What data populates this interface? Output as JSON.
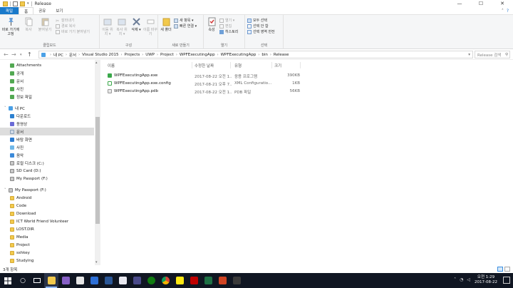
{
  "window": {
    "title": "Release",
    "controls": {
      "minimize": "—",
      "maximize": "☐",
      "close": "✕"
    }
  },
  "ribbon_tabs": [
    "파일",
    "홈",
    "공유",
    "보기"
  ],
  "ribbon": {
    "clipboard": {
      "pin_label": "바로 가기에 고정",
      "copy": "복사",
      "paste": "붙여넣기",
      "cut": "잘라내기",
      "copy_path": "경로 복사",
      "paste_shortcut": "바로 가기 붙여넣기",
      "group": "클립보드"
    },
    "organize": {
      "move_to": "이동 위치 ▾",
      "copy_to": "복사 위치 ▾",
      "delete": "삭제 ▾",
      "rename": "이름 바꾸기",
      "group": "구성"
    },
    "new": {
      "new_folder": "새 폴더",
      "new_item": "새 항목 ▾",
      "easy_access": "빠른 연결 ▾",
      "group": "새로 만들기"
    },
    "open": {
      "properties": "속성",
      "open": "열기 ▾",
      "edit": "편집",
      "history": "히스토리",
      "group": "열기"
    },
    "select": {
      "select_all": "모두 선택",
      "select_none": "선택 안 함",
      "invert": "선택 영역 반전",
      "group": "선택"
    }
  },
  "address": {
    "breadcrumbs": [
      "내 PC",
      "문서",
      "Visual Studio 2015",
      "Projects",
      "UWP",
      "Project",
      "WPFExecutingApp",
      "WPFExecutingApp",
      "bin",
      "Release"
    ],
    "search_placeholder": "Release 검색",
    "back": "←",
    "forward": "→",
    "up": "↑"
  },
  "nav": {
    "items": [
      {
        "label": "Attachments",
        "icon": "folder-icon"
      },
      {
        "label": "공개",
        "icon": "folder-icon"
      },
      {
        "label": "문서",
        "icon": "folder-icon"
      },
      {
        "label": "사진",
        "icon": "folder-icon"
      },
      {
        "label": "정보 파일",
        "icon": "folder-icon"
      },
      {
        "label": "내 PC",
        "icon": "pc-icon"
      },
      {
        "label": "다운로드",
        "icon": "download-icon"
      },
      {
        "label": "동영상",
        "icon": "video-icon"
      },
      {
        "label": "문서",
        "icon": "documents-icon"
      },
      {
        "label": "바탕 화면",
        "icon": "desktop-icon"
      },
      {
        "label": "사진",
        "icon": "pictures-icon"
      },
      {
        "label": "음악",
        "icon": "music-icon"
      },
      {
        "label": "로컬 디스크 (C:)",
        "icon": "drive-icon"
      },
      {
        "label": "SD Card (D:)",
        "icon": "drive-icon"
      },
      {
        "label": "My Passport (F:)",
        "icon": "drive-icon"
      },
      {
        "label": "My Passport (F:)",
        "icon": "drive-icon"
      },
      {
        "label": "Android",
        "icon": "folder-icon"
      },
      {
        "label": "Code",
        "icon": "folder-icon"
      },
      {
        "label": "Download",
        "icon": "folder-icon"
      },
      {
        "label": "ICT World Friend Volunteer",
        "icon": "folder-icon"
      },
      {
        "label": "LOST.DIR",
        "icon": "folder-icon"
      },
      {
        "label": "Media",
        "icon": "folder-icon"
      },
      {
        "label": "Project",
        "icon": "folder-icon"
      },
      {
        "label": "sshkey",
        "icon": "folder-icon"
      },
      {
        "label": "Studying",
        "icon": "folder-icon"
      }
    ]
  },
  "files": {
    "columns": [
      "이름",
      "수정한 날짜",
      "유형",
      "크기"
    ],
    "rows": [
      {
        "name": "WPFExecutingApp.exe",
        "date": "2017-08-22 오전 1...",
        "type": "응용 프로그램",
        "size": "390KB"
      },
      {
        "name": "WPFExecutingApp.exe.config",
        "date": "2017-08-21 오후 7...",
        "type": "XML Configuratio...",
        "size": "1KB"
      },
      {
        "name": "WPFExecutingApp.pdb",
        "date": "2017-08-22 오전 1...",
        "type": "PDB 파일",
        "size": "56KB"
      }
    ]
  },
  "status": {
    "count": "3개 항목"
  },
  "taskbar": {
    "clock_time": "오전 1:29",
    "clock_date": "2017-08-22",
    "apps": [
      "start-icon",
      "search-icon",
      "task-view-icon",
      "explorer-icon",
      "visual-studio-icon",
      "store-icon",
      "photos-icon",
      "word-icon",
      "onenote-icon",
      "app-icon",
      "xbox-icon",
      "chrome-icon",
      "kakaotalk-icon",
      "filezilla-icon",
      "excel-icon",
      "ppt-icon",
      "app2-icon"
    ]
  },
  "colors": {
    "accent": "#1979ca",
    "taskbar": "#101622",
    "selection": "#dddddd"
  }
}
